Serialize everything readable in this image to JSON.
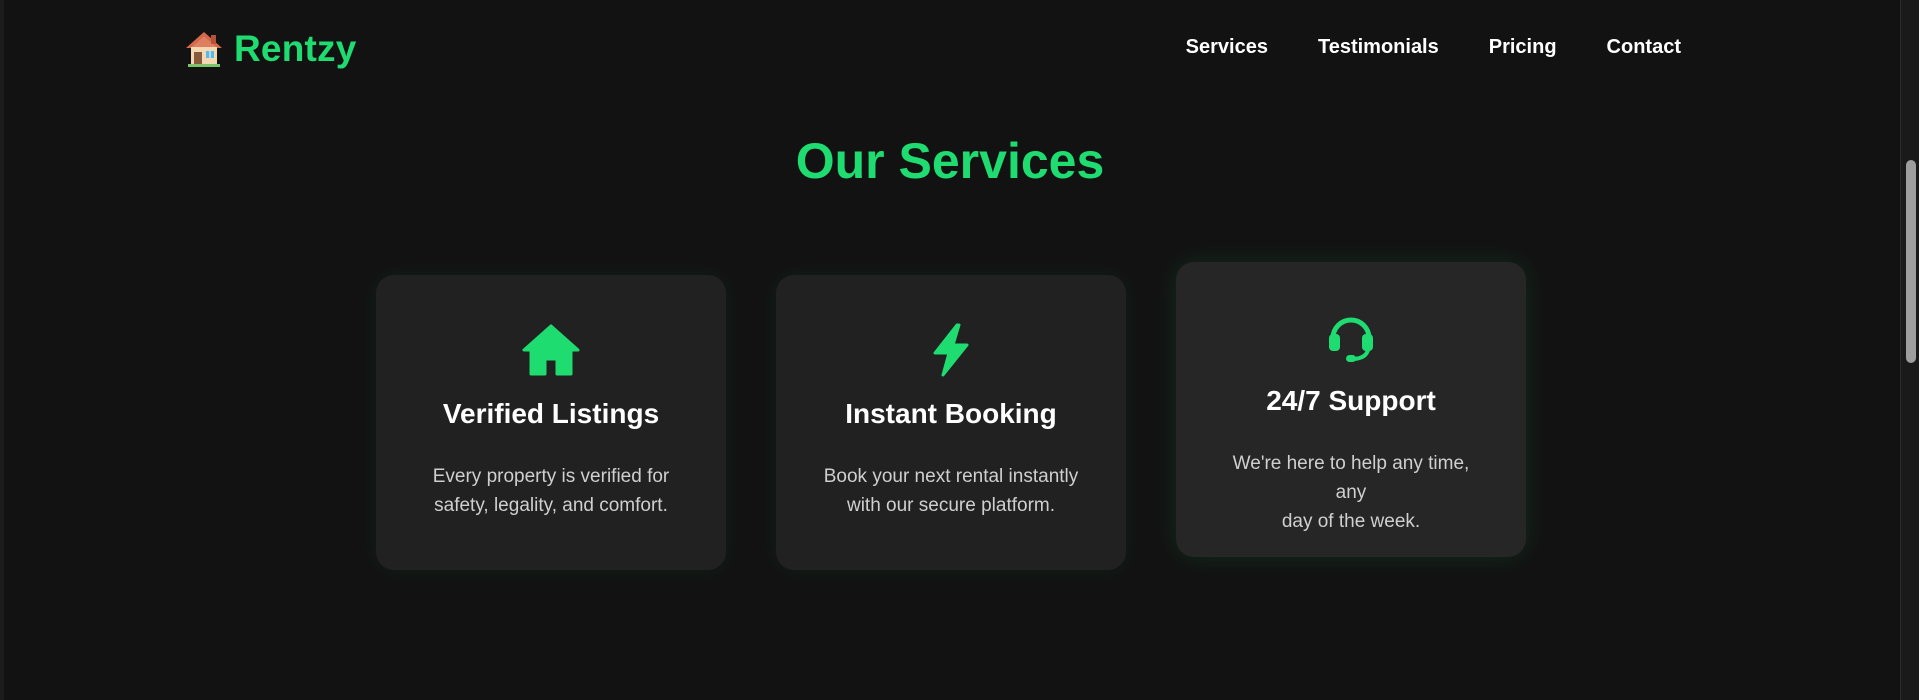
{
  "brand": {
    "name": "Rentzy",
    "icon": "house-emoji-icon",
    "accent_color": "#1fdc71"
  },
  "nav": {
    "items": [
      {
        "label": "Services"
      },
      {
        "label": "Testimonials"
      },
      {
        "label": "Pricing"
      },
      {
        "label": "Contact"
      }
    ]
  },
  "services": {
    "title": "Our Services",
    "cards": [
      {
        "icon": "house-icon",
        "title": "Verified Listings",
        "desc_line1": "Every property is verified for",
        "desc_line2": "safety, legality, and comfort."
      },
      {
        "icon": "lightning-bolt-icon",
        "title": "Instant Booking",
        "desc_line1": "Book your next rental instantly",
        "desc_line2": "with our secure platform."
      },
      {
        "icon": "headset-icon",
        "title": "24/7 Support",
        "desc_line1": "We're here to help any time, any",
        "desc_line2": "day of the week."
      }
    ]
  }
}
